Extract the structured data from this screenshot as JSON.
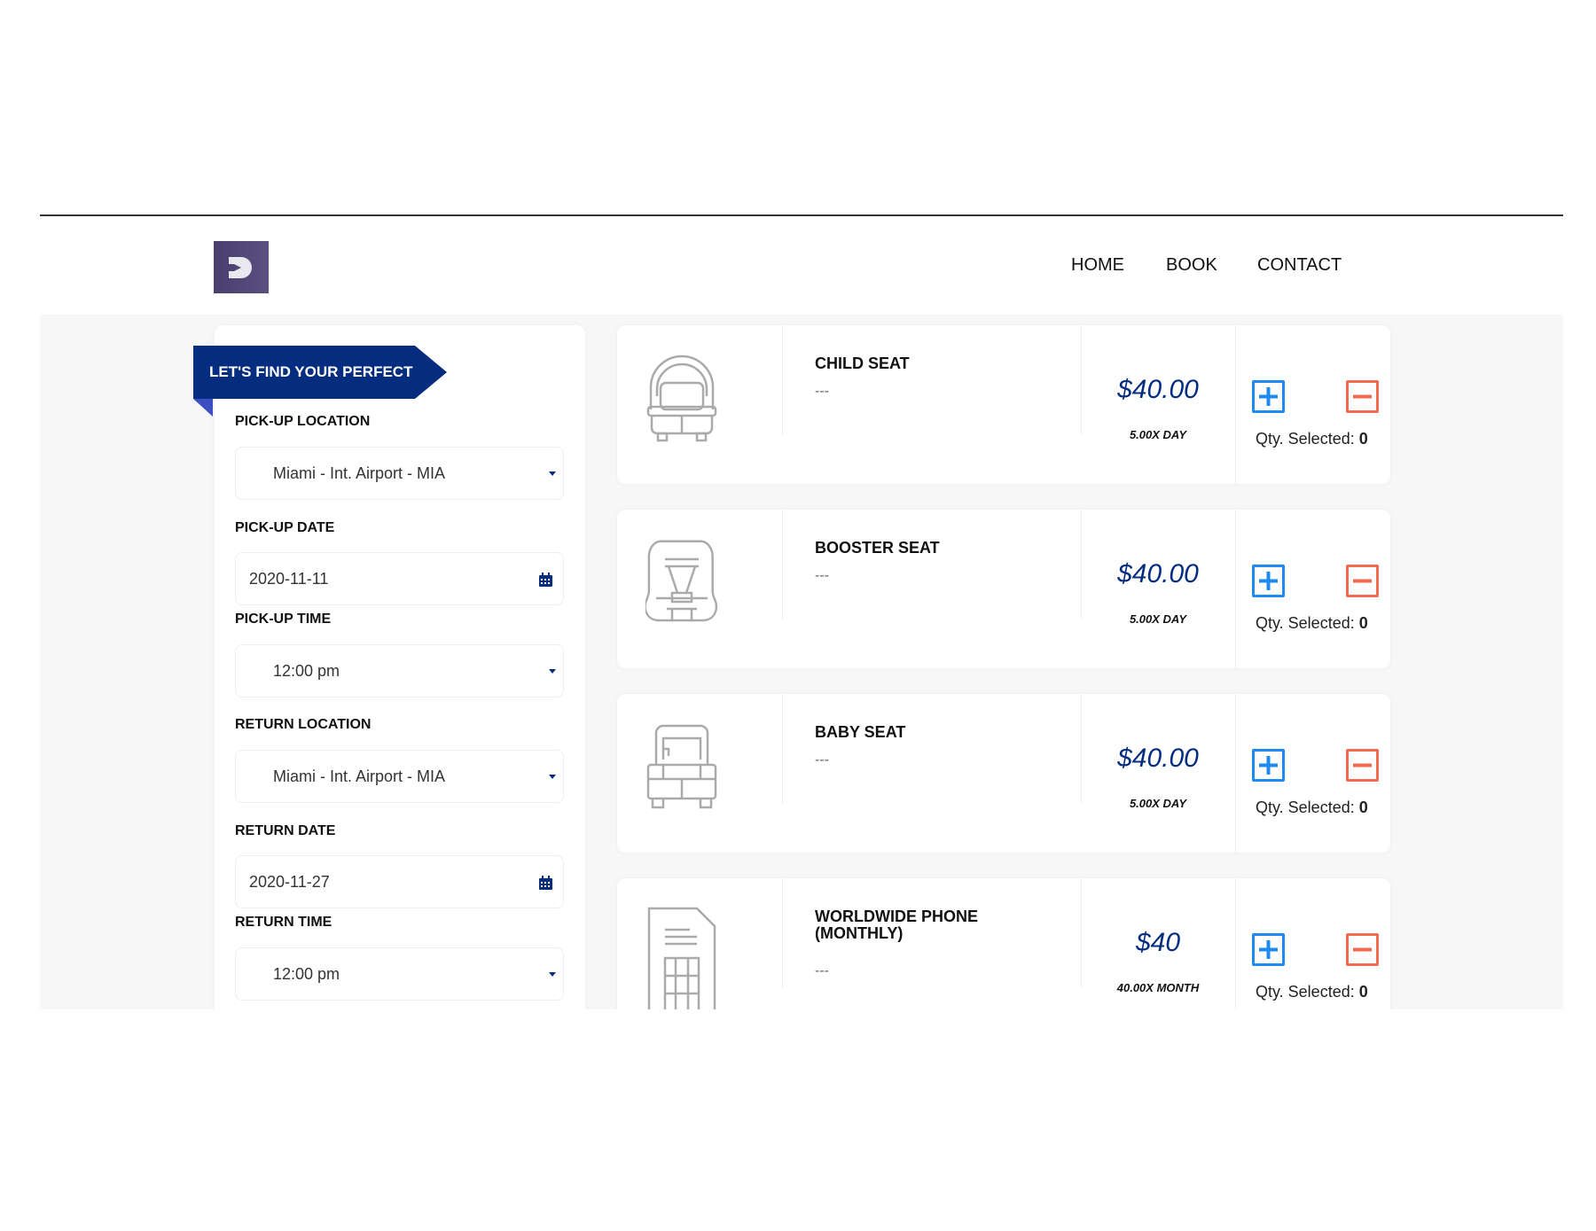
{
  "nav": {
    "items": [
      "HOME",
      "BOOK",
      "CONTACT"
    ]
  },
  "search": {
    "banner": "LET'S FIND YOUR PERFECT CAR",
    "pickup_location_label": "PICK-UP LOCATION",
    "pickup_location": "Miami - Int. Airport - MIA",
    "pickup_date_label": "PICK-UP DATE",
    "pickup_date": "2020-11-11",
    "pickup_time_label": "PICK-UP TIME",
    "pickup_time": "12:00 pm",
    "return_location_label": "RETURN LOCATION",
    "return_location": "Miami - Int. Airport - MIA",
    "return_date_label": "RETURN DATE",
    "return_date": "2020-11-27",
    "return_time_label": "RETURN TIME",
    "return_time": "12:00 pm"
  },
  "qty_label": "Qty. Selected:",
  "extras": [
    {
      "title": "CHILD SEAT",
      "desc": "---",
      "price": "$40.00",
      "unit": "5.00X DAY",
      "qty": "0",
      "icon": "child-seat-icon"
    },
    {
      "title": "BOOSTER SEAT",
      "desc": "---",
      "price": "$40.00",
      "unit": "5.00X DAY",
      "qty": "0",
      "icon": "booster-seat-icon"
    },
    {
      "title": "BABY SEAT",
      "desc": "---",
      "price": "$40.00",
      "unit": "5.00X DAY",
      "qty": "0",
      "icon": "baby-seat-icon"
    },
    {
      "title": "WORLDWIDE PHONE (MONTHLY)",
      "desc": "---",
      "price": "$40",
      "unit": "40.00X MONTH",
      "qty": "0",
      "icon": "sim-card-icon"
    }
  ],
  "colors": {
    "brand": "#052d7f",
    "plus": "#1e8af0",
    "minus": "#f26a4f"
  }
}
